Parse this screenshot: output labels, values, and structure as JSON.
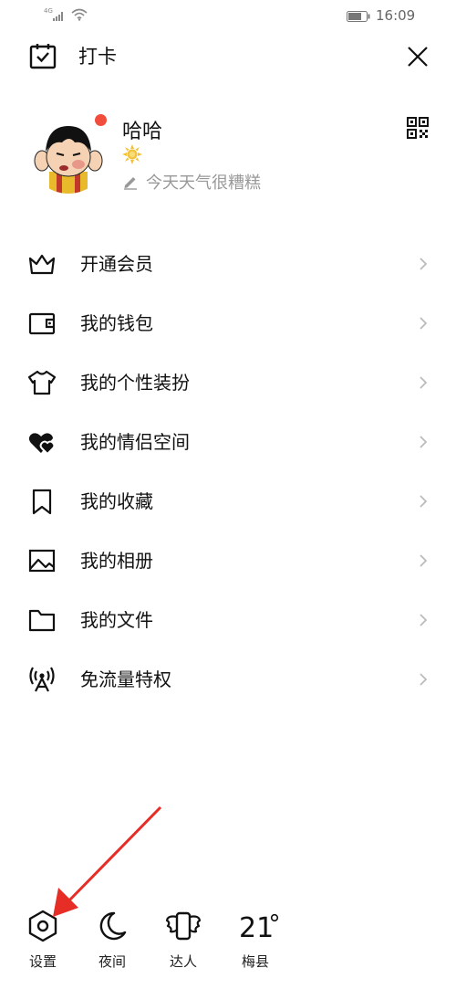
{
  "status_bar": {
    "network": "4G",
    "time": "16:09"
  },
  "header": {
    "checkin_label": "打卡"
  },
  "profile": {
    "username": "哈哈",
    "signature": "今天天气很糟糕"
  },
  "menu": [
    {
      "label": "开通会员",
      "icon": "crown-icon"
    },
    {
      "label": "我的钱包",
      "icon": "wallet-icon"
    },
    {
      "label": "我的个性装扮",
      "icon": "tshirt-icon"
    },
    {
      "label": "我的情侣空间",
      "icon": "hearts-icon"
    },
    {
      "label": "我的收藏",
      "icon": "bookmark-icon"
    },
    {
      "label": "我的相册",
      "icon": "image-icon"
    },
    {
      "label": "我的文件",
      "icon": "folder-icon"
    },
    {
      "label": "免流量特权",
      "icon": "antenna-icon"
    }
  ],
  "toolbar": {
    "settings_label": "设置",
    "night_label": "夜间",
    "expert_label": "达人",
    "weather_temp": "21",
    "weather_city": "梅县"
  },
  "colors": {
    "accent_red": "#f24c3d",
    "annotation_red": "#e62e26",
    "text_primary": "#111111",
    "text_secondary": "#999999",
    "chevron": "#bbbbbb"
  }
}
